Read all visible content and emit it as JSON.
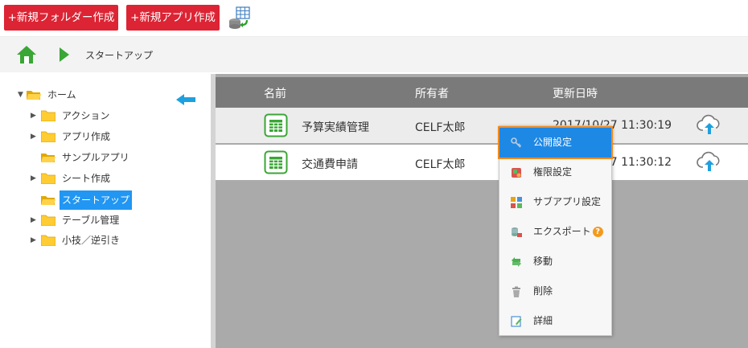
{
  "toolbar": {
    "new_folder_label": "+新規フォルダー作成",
    "new_app_label": "+新規アプリ作成",
    "db_icon": "database-import-icon"
  },
  "breadcrumb": {
    "home_icon": "home-icon",
    "separator_icon": "play-arrow-icon",
    "current": "スタートアップ"
  },
  "tree": {
    "root": {
      "label": "ホーム",
      "expanded": true
    },
    "items": [
      {
        "label": "アクション",
        "expandable": true
      },
      {
        "label": "アプリ作成",
        "expandable": true
      },
      {
        "label": "サンプルアプリ",
        "expandable": false
      },
      {
        "label": "シート作成",
        "expandable": true
      },
      {
        "label": "スタートアップ",
        "expandable": false,
        "selected": true
      },
      {
        "label": "テーブル管理",
        "expandable": true
      },
      {
        "label": "小技／逆引き",
        "expandable": true
      }
    ]
  },
  "list": {
    "columns": {
      "name": "名前",
      "owner": "所有者",
      "updated": "更新日時"
    },
    "rows": [
      {
        "name": "予算実績管理",
        "owner": "CELF太郎",
        "updated": "2017/10/27 11:30:19"
      },
      {
        "name": "交通費申請",
        "owner": "CELF太郎",
        "updated": "2017/10/27 11:30:12"
      }
    ]
  },
  "context_menu": {
    "items": [
      {
        "label": "公開設定",
        "icon": "key-icon",
        "active": true
      },
      {
        "label": "権限設定",
        "icon": "permission-icon"
      },
      {
        "label": "サブアプリ設定",
        "icon": "subapp-icon"
      },
      {
        "label": "エクスポート",
        "icon": "export-icon"
      },
      {
        "label": "移動",
        "icon": "move-icon"
      },
      {
        "label": "削除",
        "icon": "trash-icon"
      },
      {
        "label": "詳細",
        "icon": "details-icon"
      }
    ],
    "help_glyph": "?"
  },
  "colors": {
    "accent_red": "#dc2434",
    "selection_blue": "#1e88e5",
    "highlight_orange": "#f28a1e",
    "app_green": "#3aa635"
  }
}
